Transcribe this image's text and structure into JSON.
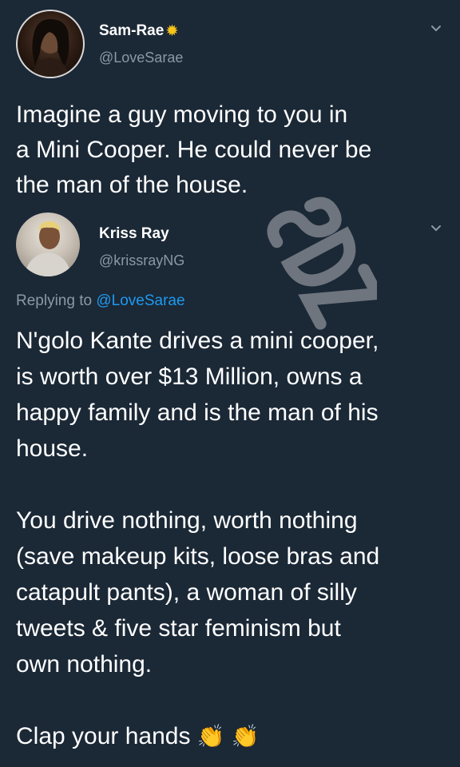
{
  "colors": {
    "background": "#1b2836",
    "text": "#ffffff",
    "secondary": "#8b98a5",
    "link": "#1d9bf0",
    "badge": "#f5c518"
  },
  "original_tweet": {
    "display_name": "Sam-Rae",
    "badge_icon": "sun-icon",
    "handle": "@LoveSarae",
    "text": "Imagine a guy moving to you in\na Mini Cooper. He could never be\nthe man of the house."
  },
  "reply_tweet": {
    "display_name": "Kriss Ray",
    "handle": "@krissrayNG",
    "replying_prefix": "Replying to ",
    "replying_to": "@LoveSarae",
    "text": "N'golo Kante drives a mini cooper,\nis worth over $13 Million, owns a\nhappy family and is the man of his\nhouse.\n\nYou drive nothing, worth nothing\n(save makeup kits, loose bras and\ncatapult pants), a woman of silly\ntweets & five star feminism but\nown nothing.\n\nClap your hands",
    "trailing_emoji": "👏 👏"
  },
  "watermark": {
    "text": "SDZ"
  }
}
